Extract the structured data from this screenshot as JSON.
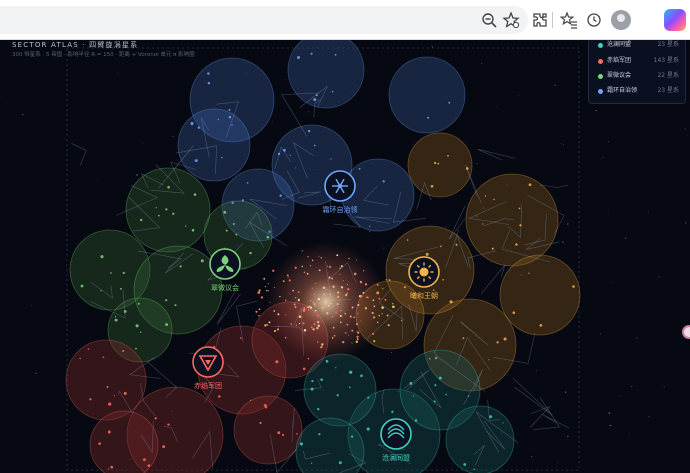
{
  "browser": {
    "icons": [
      "zoom-icon",
      "favorite-star-icon",
      "extensions-icon",
      "favorites-list-icon",
      "history-icon",
      "profile-icon",
      "copilot-icon"
    ]
  },
  "header": {
    "title": "SECTOR ATLAS · 四臂旋涡星系",
    "subtitle": "300 恒星系 · 5 帝国 · 影响半径 R = 150 · 距离 + Voronoi 单元 π 影响圈"
  },
  "legend": {
    "items": [
      {
        "name": "沧澜同盟",
        "count": "23 星系",
        "color": "#3fd2c2"
      },
      {
        "name": "赤焰军团",
        "count": "143 星系",
        "color": "#ff6b5e"
      },
      {
        "name": "翠微议会",
        "count": "22 星系",
        "color": "#7bd37a"
      },
      {
        "name": "霜环自治领",
        "count": "23 星系",
        "color": "#6fa6ff"
      }
    ]
  },
  "empires": [
    {
      "name": "霜环自治领",
      "icon": "snowflake-icon",
      "color": "#6fa6ff"
    },
    {
      "name": "曦和王朝",
      "icon": "sun-icon",
      "color": "#f4b34a"
    },
    {
      "name": "翠微议会",
      "icon": "leaf-icon",
      "color": "#7bd37a"
    },
    {
      "name": "赤焰军团",
      "icon": "flame-triangle-icon",
      "color": "#ff6b5e"
    },
    {
      "name": "沧澜同盟",
      "icon": "wave-icon",
      "color": "#3fd2c2"
    }
  ]
}
